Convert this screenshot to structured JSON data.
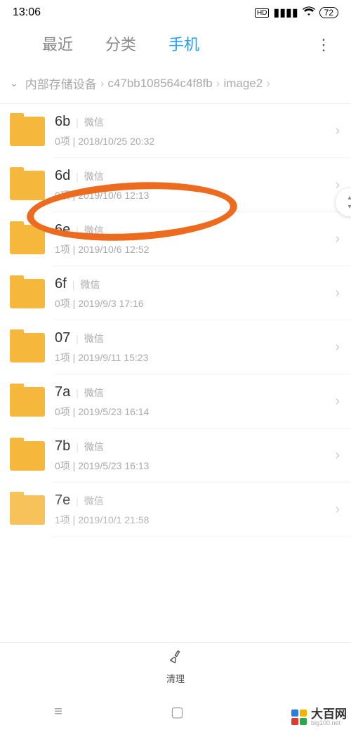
{
  "status": {
    "time": "13:06",
    "battery": "72",
    "hd": "HD"
  },
  "tabs": {
    "items": [
      "最近",
      "分类",
      "手机"
    ],
    "active_index": 2
  },
  "breadcrumb": {
    "root": "内部存储设备",
    "mid": "c47bb108564c4f8fb",
    "leaf": "image2"
  },
  "folders": [
    {
      "name": "6b",
      "source": "微信",
      "count": "0项",
      "date": "2018/10/25 20:32"
    },
    {
      "name": "6d",
      "source": "微信",
      "count": "0项",
      "date": "2019/10/6 12:13"
    },
    {
      "name": "6e",
      "source": "微信",
      "count": "1项",
      "date": "2019/10/6 12:52"
    },
    {
      "name": "6f",
      "source": "微信",
      "count": "0项",
      "date": "2019/9/3 17:16"
    },
    {
      "name": "07",
      "source": "微信",
      "count": "1项",
      "date": "2019/9/11 15:23"
    },
    {
      "name": "7a",
      "source": "微信",
      "count": "0项",
      "date": "2019/5/23 16:14"
    },
    {
      "name": "7b",
      "source": "微信",
      "count": "0项",
      "date": "2019/5/23 16:13"
    },
    {
      "name": "7e",
      "source": "微信",
      "count": "1项",
      "date": "2019/10/1 21:58"
    }
  ],
  "bottom": {
    "clean": "清理"
  },
  "watermark": {
    "cn": "大百网",
    "en": "big100.net"
  }
}
